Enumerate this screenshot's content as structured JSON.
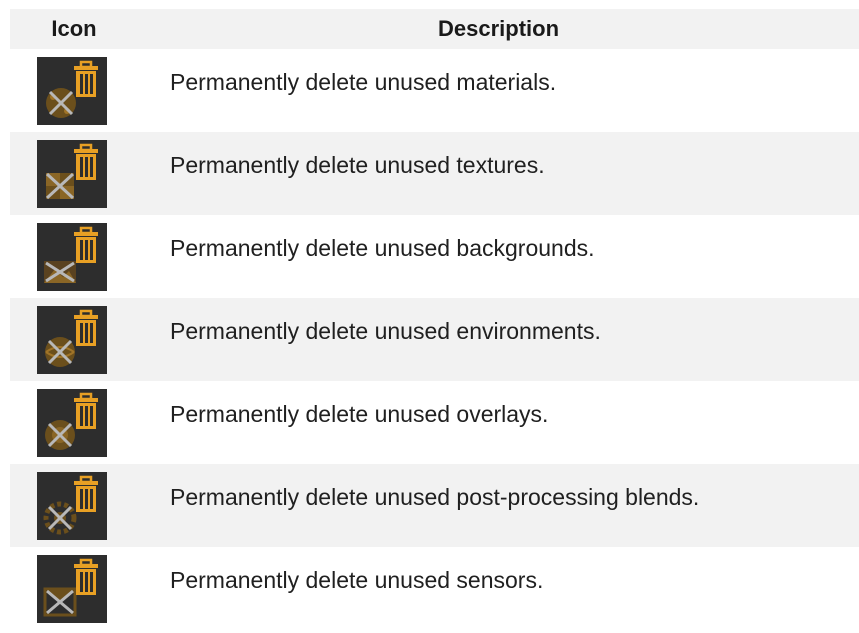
{
  "table": {
    "header": {
      "icon": "Icon",
      "description": "Description"
    },
    "rows": [
      {
        "icon": "purge-materials-icon",
        "description": "Permanently delete unused materials."
      },
      {
        "icon": "purge-textures-icon",
        "description": "Permanently delete unused textures."
      },
      {
        "icon": "purge-backgrounds-icon",
        "description": "Permanently delete unused backgrounds."
      },
      {
        "icon": "purge-environments-icon",
        "description": "Permanently delete unused environments."
      },
      {
        "icon": "purge-overlays-icon",
        "description": "Permanently delete unused overlays."
      },
      {
        "icon": "purge-post-processing-blends-icon",
        "description": "Permanently delete unused post-processing blends."
      },
      {
        "icon": "purge-sensors-icon",
        "description": "Permanently delete unused sensors."
      }
    ]
  },
  "colors": {
    "icon_background": "#2d2d2d",
    "trash_orange": "#e8a024",
    "cross_gray": "#b8b8b8",
    "item_brown": "#6b4f1c",
    "row_shade": "#f2f2f2"
  }
}
